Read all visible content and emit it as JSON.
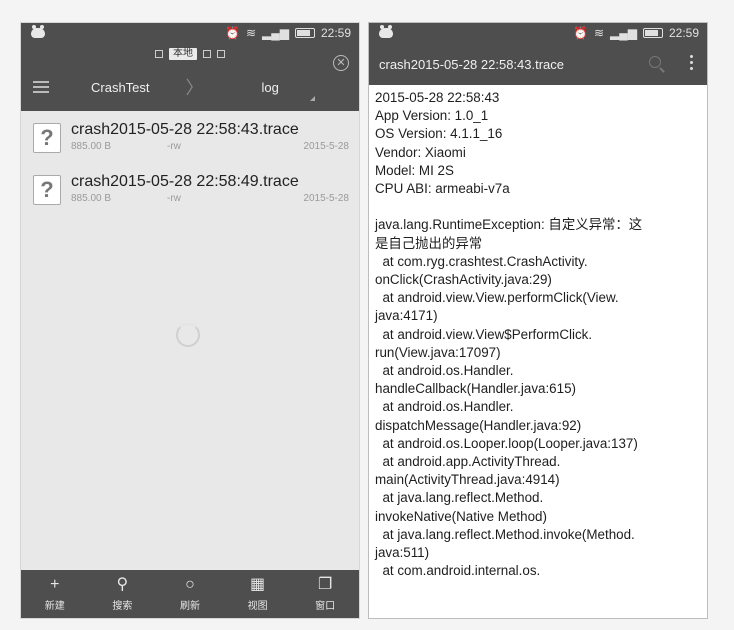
{
  "status_bar": {
    "time": "22:59",
    "alarm_icon": "alarm-clock-icon",
    "wifi_icon": "wifi-icon",
    "signal_icon": "signal-bars-icon",
    "battery_icon": "battery-icon"
  },
  "left_screen": {
    "tabs": {
      "local_label": "本地"
    },
    "breadcrumb": {
      "app": "CrashTest",
      "separator": "〉",
      "folder": "log"
    },
    "files": [
      {
        "name": "crash2015-05-28 22:58:43.trace",
        "size": "885.00 B",
        "perm": "-rw",
        "date": "2015-5-28"
      },
      {
        "name": "crash2015-05-28 22:58:49.trace",
        "size": "885.00 B",
        "perm": "-rw",
        "date": "2015-5-28"
      }
    ],
    "bottom_bar": [
      {
        "icon": "+",
        "label": "新建"
      },
      {
        "icon": "⚲",
        "label": "搜索"
      },
      {
        "icon": "○",
        "label": "刷新"
      },
      {
        "icon": "▦",
        "label": "视图"
      },
      {
        "icon": "❐",
        "label": "窗口"
      }
    ]
  },
  "right_screen": {
    "title": "crash2015-05-28 22:58:43.trace",
    "lines_top": [
      "2015-05-28 22:58:43",
      "App Version: 1.0_1",
      "OS Version: 4.1.1_16",
      "Vendor: Xiaomi",
      "Model: MI 2S",
      "CPU ABI: armeabi-v7a"
    ],
    "lines_trace": [
      "java.lang.RuntimeException: 自定义异常：这",
      "是自己抛出的异常",
      "  at com.ryg.crashtest.CrashActivity.",
      "onClick(CrashActivity.java:29)",
      "  at android.view.View.performClick(View.",
      "java:4171)",
      "  at android.view.View$PerformClick.",
      "run(View.java:17097)",
      "  at android.os.Handler.",
      "handleCallback(Handler.java:615)",
      "  at android.os.Handler.",
      "dispatchMessage(Handler.java:92)",
      "  at android.os.Looper.loop(Looper.java:137)",
      "  at android.app.ActivityThread.",
      "main(ActivityThread.java:4914)",
      "  at java.lang.reflect.Method.",
      "invokeNative(Native Method)",
      "  at java.lang.reflect.Method.invoke(Method.",
      "java:511)"
    ],
    "cut_line": "  at com.android.internal.os."
  }
}
